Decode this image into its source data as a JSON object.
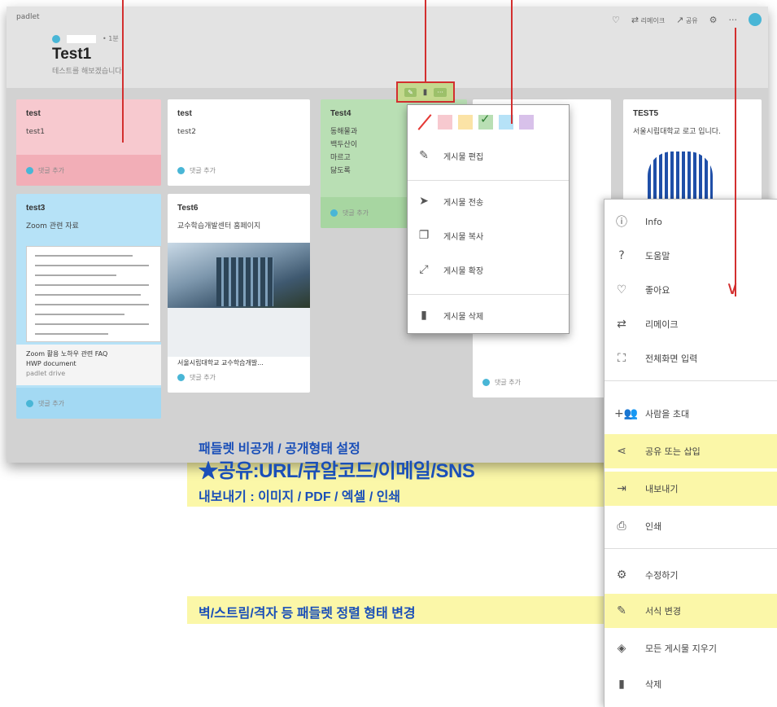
{
  "app": {
    "brand": "padlet",
    "topbar": {
      "remake": "리메이크",
      "share": "공유"
    },
    "author_meta": "1분",
    "board_title": "Test1",
    "board_description": "테스트를 해보겠습니다."
  },
  "comment_label": "댓글 추가",
  "cards": {
    "c1": {
      "title": "test",
      "body": "test1"
    },
    "c2": {
      "title": "test",
      "body": "test2"
    },
    "c3": {
      "title": "Test4",
      "body": "동해물과\n백두산이\n마르고\n닳도록"
    },
    "c4": {
      "title": "TEST5",
      "body": "서울시립대학교 로고 입니다."
    },
    "c5": {
      "title": "test3",
      "body": "Zoom 관련 자료",
      "doc_title": "Zoom 활용 노하우 관련 FAQ",
      "doc_type": "HWP document",
      "doc_source": "padlet drive"
    },
    "c6": {
      "title": "Test6",
      "body": "교수학습개발센터 홈페이지",
      "link_title": "서울시립대학교 교수학습개발..."
    }
  },
  "post_menu": {
    "colors": [
      "none",
      "#f7c9cf",
      "#fbe3a6",
      "#b9dfb4",
      "#b6e2f7",
      "#d8c1ea"
    ],
    "selected_color": "#b9dfb4",
    "items": {
      "edit": "게시물 편집",
      "transfer": "게시물 전송",
      "copy": "게시물 복사",
      "expand": "게시물 확장",
      "delete": "게시물 삭제"
    }
  },
  "more_menu": {
    "info": "Info",
    "help": "도움말",
    "like": "좋아요",
    "remake": "리메이크",
    "fullscreen": "전체화면 입력",
    "invite": "사람을 초대",
    "share": "공유 또는 삽입",
    "export": "내보내기",
    "print": "인쇄",
    "modify": "수정하기",
    "format": "서식 변경",
    "clear": "모든 게시물 지우기",
    "delete": "삭제"
  },
  "annotations": {
    "share_line1": "패들렛 비공개 / 공개형태 설정",
    "share_line2": "★공유:URL/큐알코드/이메일/SNS",
    "share_line3": "내보내기 : 이미지 / PDF / 엑셀 / 인쇄",
    "format_line": "벽/스트림/격자 등 패들렛 정렬 형태 변경"
  },
  "colors": {
    "annotation_red": "#d32f2f",
    "annotation_blue": "#1a4fb8",
    "highlight_yellow": "#fbf7a8"
  }
}
